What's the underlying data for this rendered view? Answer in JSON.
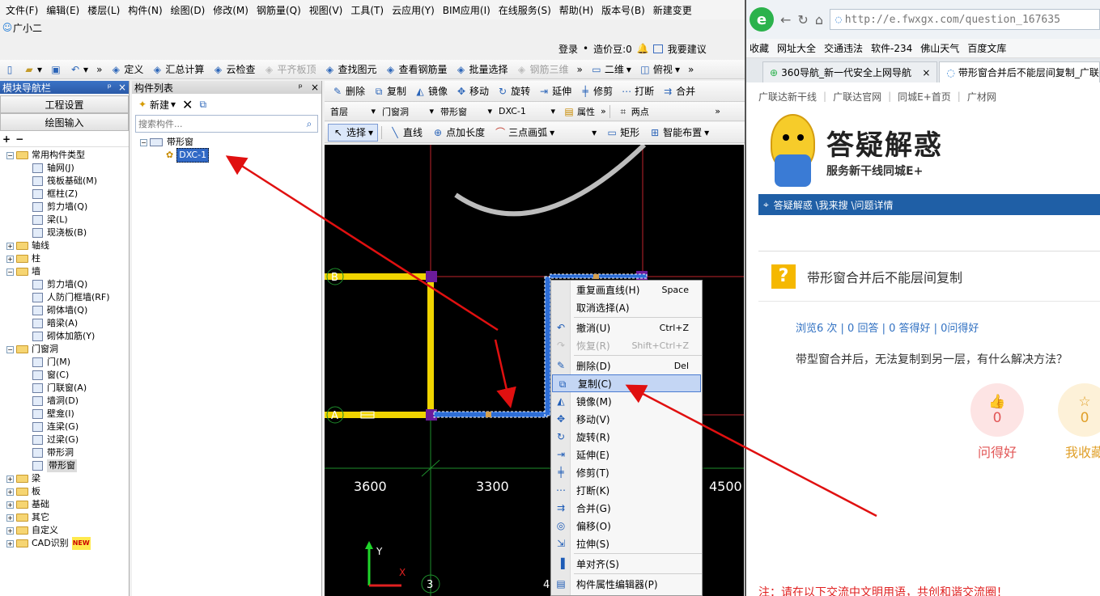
{
  "menu": {
    "row1": [
      "文件(F)",
      "编辑(E)",
      "楼层(L)",
      "构件(N)",
      "绘图(D)",
      "修改(M)",
      "钢筋量(Q)",
      "视图(V)",
      "工具(T)",
      "云应用(Y)",
      "BIM应用(I)",
      "在线服务(S)",
      "帮助(H)",
      "版本号(B)",
      "新建变更"
    ],
    "row1_more": "▾",
    "row2": [
      "广小二"
    ]
  },
  "status_bar": {
    "login": "登录",
    "price_bean": "造价豆:0",
    "suggest": "我要建议"
  },
  "toolbar_main": {
    "items": [
      {
        "label": "定义",
        "icon": "define-icon"
      },
      {
        "label": "汇总计算",
        "icon": "sigma-icon"
      },
      {
        "label": "云检查",
        "icon": "cloud-check-icon"
      },
      {
        "label": "平齐板顶",
        "icon": "align-top-icon",
        "disabled": true
      },
      {
        "label": "查找图元",
        "icon": "binoculars-icon"
      },
      {
        "label": "查看钢筋量",
        "icon": "glasses-icon"
      },
      {
        "label": "批量选择",
        "icon": "batch-select-icon"
      },
      {
        "label": "钢筋三维",
        "icon": "rebar-3d-icon",
        "disabled": true
      }
    ],
    "view_2d": "二维",
    "view_top": "俯视"
  },
  "left_panel": {
    "title": "模块导航栏",
    "pin": "ᵖ",
    "close": "×",
    "btn_project": "工程设置",
    "btn_draw": "绘图输入",
    "tree": [
      {
        "level": 0,
        "toggle": "−",
        "folder": true,
        "label": "常用构件类型"
      },
      {
        "level": 2,
        "label": "轴网(J)"
      },
      {
        "level": 2,
        "label": "筏板基础(M)"
      },
      {
        "level": 2,
        "label": "框柱(Z)"
      },
      {
        "level": 2,
        "label": "剪力墙(Q)"
      },
      {
        "level": 2,
        "label": "梁(L)"
      },
      {
        "level": 2,
        "label": "现浇板(B)"
      },
      {
        "level": 0,
        "toggle": "+",
        "folder": true,
        "label": "轴线"
      },
      {
        "level": 0,
        "toggle": "+",
        "folder": true,
        "label": "柱"
      },
      {
        "level": 0,
        "toggle": "−",
        "folder": true,
        "label": "墙"
      },
      {
        "level": 2,
        "label": "剪力墙(Q)"
      },
      {
        "level": 2,
        "label": "人防门框墙(RF)"
      },
      {
        "level": 2,
        "label": "砌体墙(Q)"
      },
      {
        "level": 2,
        "label": "暗梁(A)"
      },
      {
        "level": 2,
        "label": "砌体加筋(Y)"
      },
      {
        "level": 0,
        "toggle": "−",
        "folder": true,
        "label": "门窗洞"
      },
      {
        "level": 2,
        "label": "门(M)"
      },
      {
        "level": 2,
        "label": "窗(C)"
      },
      {
        "level": 2,
        "label": "门联窗(A)"
      },
      {
        "level": 2,
        "label": "墙洞(D)"
      },
      {
        "level": 2,
        "label": "壁龛(I)"
      },
      {
        "level": 2,
        "label": "连梁(G)"
      },
      {
        "level": 2,
        "label": "过梁(G)"
      },
      {
        "level": 2,
        "label": "带形洞"
      },
      {
        "level": 2,
        "label": "带形窗",
        "selected": true
      },
      {
        "level": 0,
        "toggle": "+",
        "folder": true,
        "label": "梁"
      },
      {
        "level": 0,
        "toggle": "+",
        "folder": true,
        "label": "板"
      },
      {
        "level": 0,
        "toggle": "+",
        "folder": true,
        "label": "基础"
      },
      {
        "level": 0,
        "toggle": "+",
        "folder": true,
        "label": "其它"
      },
      {
        "level": 0,
        "toggle": "+",
        "folder": true,
        "label": "自定义"
      },
      {
        "level": 0,
        "toggle": "+",
        "folder": true,
        "label": "CAD识别",
        "badge": "NEW"
      }
    ]
  },
  "component_list": {
    "title": "构件列表",
    "new_label": "新建",
    "search_placeholder": "搜索构件...",
    "group": "带形窗",
    "item": "DXC-1"
  },
  "edit_toolbar": [
    "删除",
    "复制",
    "镜像",
    "移动",
    "旋转",
    "延伸",
    "修剪",
    "打断",
    "合并"
  ],
  "prop_toolbar": {
    "floor": "首层",
    "category": "门窗洞",
    "type": "带形窗",
    "component": "DXC-1",
    "props": "属性",
    "two_points": "两点"
  },
  "draw_toolbar": {
    "select": "选择",
    "line": "直线",
    "point_len": "点加长度",
    "arc": "三点画弧",
    "rect": "矩形",
    "smart": "智能布置"
  },
  "canvas": {
    "axis_labels": [
      "B",
      "A",
      "3",
      "4"
    ],
    "dims": [
      "3600",
      "3300",
      "4500"
    ],
    "x_label": "X",
    "y_label": "Y"
  },
  "context_menu": [
    {
      "label": "重复画直线(H)",
      "shortcut": "Space",
      "icon": ""
    },
    {
      "label": "取消选择(A)",
      "shortcut": "",
      "icon": ""
    },
    {
      "sep": true
    },
    {
      "label": "撤消(U)",
      "shortcut": "Ctrl+Z",
      "icon": "undo-icon"
    },
    {
      "label": "恢复(R)",
      "shortcut": "Shift+Ctrl+Z",
      "icon": "redo-icon",
      "disabled": true
    },
    {
      "sep": true
    },
    {
      "label": "删除(D)",
      "shortcut": "Del",
      "icon": "delete-icon"
    },
    {
      "label": "复制(C)",
      "shortcut": "",
      "icon": "copy-icon",
      "highlight": true
    },
    {
      "label": "镜像(M)",
      "shortcut": "",
      "icon": "mirror-icon"
    },
    {
      "label": "移动(V)",
      "shortcut": "",
      "icon": "move-icon"
    },
    {
      "label": "旋转(R)",
      "shortcut": "",
      "icon": "rotate-icon"
    },
    {
      "label": "延伸(E)",
      "shortcut": "",
      "icon": "extend-icon"
    },
    {
      "label": "修剪(T)",
      "shortcut": "",
      "icon": "trim-icon"
    },
    {
      "label": "打断(K)",
      "shortcut": "",
      "icon": "break-icon"
    },
    {
      "label": "合并(G)",
      "shortcut": "",
      "icon": "merge-icon"
    },
    {
      "label": "偏移(O)",
      "shortcut": "",
      "icon": "offset-icon"
    },
    {
      "label": "拉伸(S)",
      "shortcut": "",
      "icon": "stretch-icon"
    },
    {
      "sep": true
    },
    {
      "label": "单对齐(S)",
      "shortcut": "",
      "icon": "align-icon"
    },
    {
      "sep": true
    },
    {
      "label": "构件属性编辑器(P)",
      "shortcut": "",
      "icon": "property-editor-icon"
    }
  ],
  "browser": {
    "url": "http://e.fwxgx.com/question_167635",
    "bookmarks_label": "收藏",
    "bookmarks": [
      "网址大全",
      "交通违法",
      "软件-234",
      "佛山天气",
      "百度文库"
    ],
    "tabs": [
      "360导航_新一代安全上网导航",
      "带形窗合并后不能层间复制_广联"
    ],
    "site_links": [
      "广联达新干线",
      "广联达官网",
      "同城E+首页",
      "广材网"
    ],
    "brand_title": "答疑解惑",
    "brand_sub": "服务新干线同城E+",
    "crumb": "答疑解惑 \\我来搜 \\问题详情",
    "question_title": "带形窗合并后不能层间复制",
    "stats": "浏览6 次 | 0 回答 | 0 答得好 | 0问得好",
    "question_body": "带型窗合并后，无法复制到另一层，有什么解决方法？",
    "good_count": "0",
    "good_label": "问得好",
    "fav_count": "0",
    "fav_label": "我收藏",
    "notice": "注：请在以下交流中文明用语，共创和谐交流圈！"
  }
}
